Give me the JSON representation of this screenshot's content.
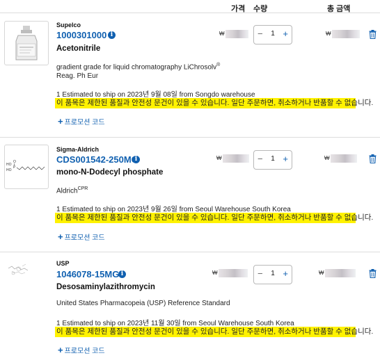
{
  "header": {
    "price_label": "가격",
    "quantity_label": "수량",
    "total_label": "총 금액"
  },
  "items": [
    {
      "brand": "Supelco",
      "product_number": "1000301000",
      "name": "Acetonitrile",
      "description_line1": "gradient grade for liquid chromatography LiChrosolv",
      "description_sup": "®",
      "description_line2": "Reag. Ph Eur",
      "shipping": "1 Estimated to ship on 2023년 9월 08일 from Songdo warehouse",
      "warning": "이 품목은 제한된 품질과 안전성 문건이 있을 수 있습니다. 일단 주문하면, 취소하거나 반품할 수 없습니다.",
      "promo": "프로모션 코드",
      "currency": "₩",
      "quantity": "1",
      "image_icon": "bottle-image"
    },
    {
      "brand": "Sigma-Aldrich",
      "product_number": "CDS001542-250MG",
      "name": "mono-N-Dodecyl phosphate",
      "description_line1": "Aldrich",
      "description_sup": "CPR",
      "description_line2": "",
      "shipping": "1 Estimated to ship on 2023년 9월 26일 from Seoul Warehouse South Korea",
      "warning": "이 품목은 제한된 품질과 안전성 문건이 있을 수 있습니다. 일단 주문하면, 취소하거나 반품할 수 없습니다.",
      "promo": "프로모션 코드",
      "currency": "₩",
      "quantity": "1",
      "image_icon": "structure-image"
    },
    {
      "brand": "USP",
      "product_number": "1046078-15MG",
      "name": "Desosaminylazithromycin",
      "description_line1": "United States Pharmacopeia (USP) Reference Standard",
      "description_sup": "",
      "description_line2": "",
      "shipping": "1 Estimated to ship on 2023년 11월 30일 from Seoul Warehouse South Korea",
      "warning": "이 품목은 제한된 품질과 안전성 문건이 있을 수 있습니다. 일단 주문하면, 취소하거나 반품할 수 없습니다.",
      "promo": "프로모션 코드",
      "currency": "₩",
      "quantity": "1",
      "image_icon": "structure-image"
    }
  ],
  "icons": {
    "info": "info-icon",
    "minus": "minus-icon",
    "plus": "plus-icon",
    "trash": "trash-icon",
    "promo_plus": "plus-icon"
  },
  "colors": {
    "link": "#1060b0",
    "warning_bg": "#fff200"
  }
}
